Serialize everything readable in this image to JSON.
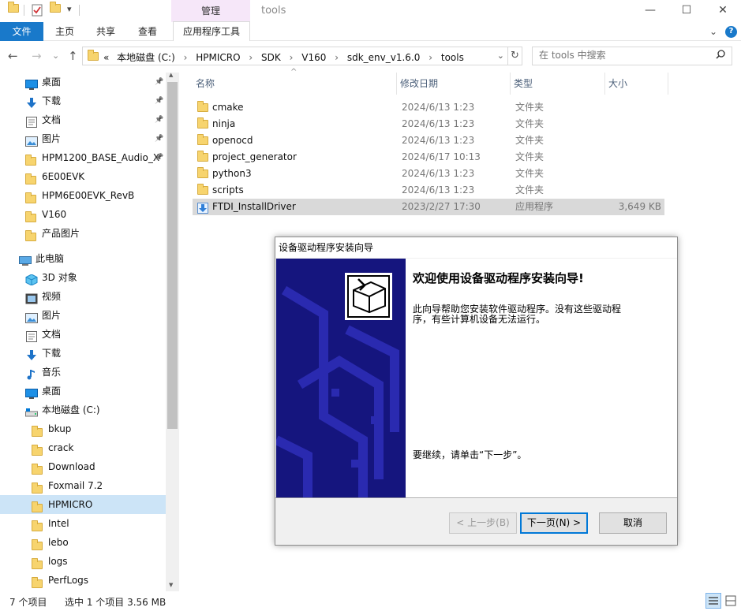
{
  "titlebar": {
    "manage_label": "管理",
    "title": "tools",
    "minimize": "—",
    "maximize": "☐",
    "close": "✕"
  },
  "ribbon": {
    "tabs": [
      "文件",
      "主页",
      "共享",
      "查看",
      "应用程序工具"
    ],
    "collapse_icon": "⌄",
    "help_icon": "?"
  },
  "nav": {
    "back": "←",
    "forward": "→",
    "recent": "⌄",
    "up": "↑",
    "overflow": "«",
    "breadcrumbs": [
      "本地磁盘 (C:)",
      "HPMICRO",
      "SDK",
      "V160",
      "sdk_env_v1.6.0",
      "tools"
    ],
    "separator": "›",
    "dropdown": "⌄",
    "refresh": "↻"
  },
  "search": {
    "placeholder": "在 tools 中搜索",
    "icon": "search-icon"
  },
  "sidebar": {
    "items": [
      {
        "label": "桌面",
        "icon": "desktop-icon",
        "pinned": true,
        "indent": 1
      },
      {
        "label": "下载",
        "icon": "download-icon",
        "pinned": true,
        "indent": 1
      },
      {
        "label": "文档",
        "icon": "document-icon",
        "pinned": true,
        "indent": 1
      },
      {
        "label": "图片",
        "icon": "picture-icon",
        "pinned": true,
        "indent": 1
      },
      {
        "label": "HPM1200_BASE_Audio_X",
        "icon": "folder-icon",
        "pinned": true,
        "indent": 1
      },
      {
        "label": "6E00EVK",
        "icon": "folder-icon",
        "pinned": false,
        "indent": 1
      },
      {
        "label": "HPM6E00EVK_RevB",
        "icon": "folder-icon",
        "pinned": false,
        "indent": 1
      },
      {
        "label": "V160",
        "icon": "folder-icon",
        "pinned": false,
        "indent": 1
      },
      {
        "label": "产品图片",
        "icon": "folder-icon",
        "pinned": false,
        "indent": 1
      },
      {
        "label": "此电脑",
        "icon": "computer-icon",
        "pinned": false,
        "indent": 0,
        "gap": true
      },
      {
        "label": "3D 对象",
        "icon": "3d-objects-icon",
        "pinned": false,
        "indent": 1
      },
      {
        "label": "视频",
        "icon": "video-icon",
        "pinned": false,
        "indent": 1
      },
      {
        "label": "图片",
        "icon": "picture-icon",
        "pinned": false,
        "indent": 1
      },
      {
        "label": "文档",
        "icon": "document-icon",
        "pinned": false,
        "indent": 1
      },
      {
        "label": "下载",
        "icon": "download-icon",
        "pinned": false,
        "indent": 1
      },
      {
        "label": "音乐",
        "icon": "music-icon",
        "pinned": false,
        "indent": 1
      },
      {
        "label": "桌面",
        "icon": "desktop-icon",
        "pinned": false,
        "indent": 1
      },
      {
        "label": "本地磁盘 (C:)",
        "icon": "drive-icon",
        "pinned": false,
        "indent": 1
      },
      {
        "label": "bkup",
        "icon": "folder-icon",
        "pinned": false,
        "indent": 2
      },
      {
        "label": "crack",
        "icon": "folder-icon",
        "pinned": false,
        "indent": 2
      },
      {
        "label": "Download",
        "icon": "folder-icon",
        "pinned": false,
        "indent": 2
      },
      {
        "label": "Foxmail 7.2",
        "icon": "folder-icon",
        "pinned": false,
        "indent": 2
      },
      {
        "label": "HPMICRO",
        "icon": "folder-icon",
        "pinned": false,
        "indent": 2,
        "selected": true
      },
      {
        "label": "Intel",
        "icon": "folder-icon",
        "pinned": false,
        "indent": 2
      },
      {
        "label": "lebo",
        "icon": "folder-icon",
        "pinned": false,
        "indent": 2
      },
      {
        "label": "logs",
        "icon": "folder-icon",
        "pinned": false,
        "indent": 2
      },
      {
        "label": "PerfLogs",
        "icon": "folder-icon",
        "pinned": false,
        "indent": 2
      }
    ],
    "scroll_up": "▲",
    "scroll_down": "▼"
  },
  "filelist": {
    "columns": [
      "名称",
      "修改日期",
      "类型",
      "大小"
    ],
    "sort_arrow": "^",
    "rows": [
      {
        "name": "cmake",
        "date": "2024/6/13 1:23",
        "type": "文件夹",
        "size": "",
        "icon": "folder-icon"
      },
      {
        "name": "ninja",
        "date": "2024/6/13 1:23",
        "type": "文件夹",
        "size": "",
        "icon": "folder-icon"
      },
      {
        "name": "openocd",
        "date": "2024/6/13 1:23",
        "type": "文件夹",
        "size": "",
        "icon": "folder-icon"
      },
      {
        "name": "project_generator",
        "date": "2024/6/17 10:13",
        "type": "文件夹",
        "size": "",
        "icon": "folder-icon"
      },
      {
        "name": "python3",
        "date": "2024/6/13 1:23",
        "type": "文件夹",
        "size": "",
        "icon": "folder-icon"
      },
      {
        "name": "scripts",
        "date": "2024/6/13 1:23",
        "type": "文件夹",
        "size": "",
        "icon": "folder-icon"
      },
      {
        "name": "FTDI_InstallDriver",
        "date": "2023/2/27 17:30",
        "type": "应用程序",
        "size": "3,649 KB",
        "icon": "installer-icon",
        "selected": true
      }
    ]
  },
  "status": {
    "count": "7 个项目",
    "selected": "选中 1 个项目  3.56 MB"
  },
  "dialog": {
    "title": "设备驱动程序安装向导",
    "heading": "欢迎使用设备驱动程序安装向导!",
    "description": "此向导帮助您安装软件驱动程序。没有这些驱动程序，有些计算机设备无法运行。",
    "continue_text": "要继续，请单击“下一步”。",
    "back_label": "< 上一步(B)",
    "next_label": "下一页(N) >",
    "cancel_label": "取消"
  },
  "colors": {
    "accent": "#1979ca",
    "manage_bg": "#f6e7f9",
    "dialog_sidebar": "#15157e",
    "selection": "#cce4f7"
  }
}
